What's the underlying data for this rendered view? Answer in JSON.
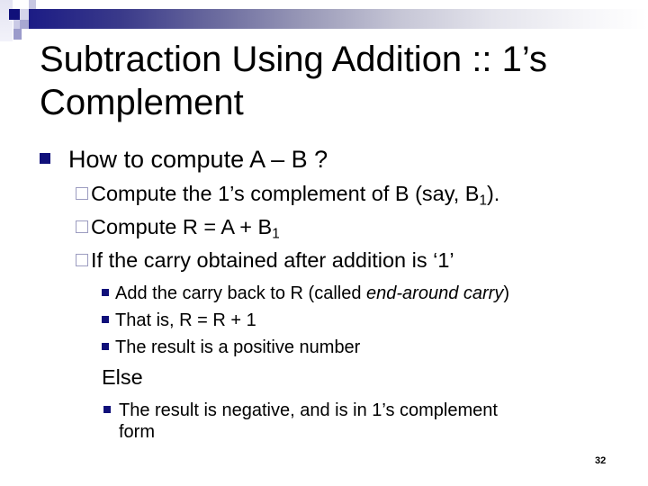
{
  "slide": {
    "title": "Subtraction Using Addition :: 1’s Complement",
    "page_number": "32",
    "colors": {
      "accent_navy": "#10107a",
      "hollow_bullet": "#9c9cc0",
      "bar_start": "#1c1c85",
      "bar_end": "#ffffff"
    },
    "bullets": {
      "level1": {
        "icon": "filled-square-icon",
        "text": "How to compute A – B ?"
      },
      "level2": [
        {
          "icon": "hollow-square-icon",
          "text_before": "Compute the 1’s complement of B (say, B",
          "subscript": "1",
          "text_after": ")."
        },
        {
          "icon": "hollow-square-icon",
          "text_before": "Compute R = A + B",
          "subscript": "1",
          "text_after": ""
        },
        {
          "icon": "hollow-square-icon",
          "text_before": "If the carry obtained after addition is ‘1’",
          "subscript": "",
          "text_after": ""
        }
      ],
      "level3_if": [
        {
          "icon": "filled-square-icon",
          "text_before": "Add the carry back to R  (called ",
          "italic": "end-around carry",
          "text_after": ")"
        },
        {
          "icon": "filled-square-icon",
          "text_before": "That is, R = R + 1",
          "italic": "",
          "text_after": ""
        },
        {
          "icon": "filled-square-icon",
          "text_before": "The result is a positive number",
          "italic": "",
          "text_after": ""
        }
      ],
      "else_label": "Else",
      "level3_else": [
        {
          "icon": "filled-square-icon",
          "line1": "The result is negative, and is in 1’s complement",
          "line2": "form"
        }
      ]
    }
  }
}
